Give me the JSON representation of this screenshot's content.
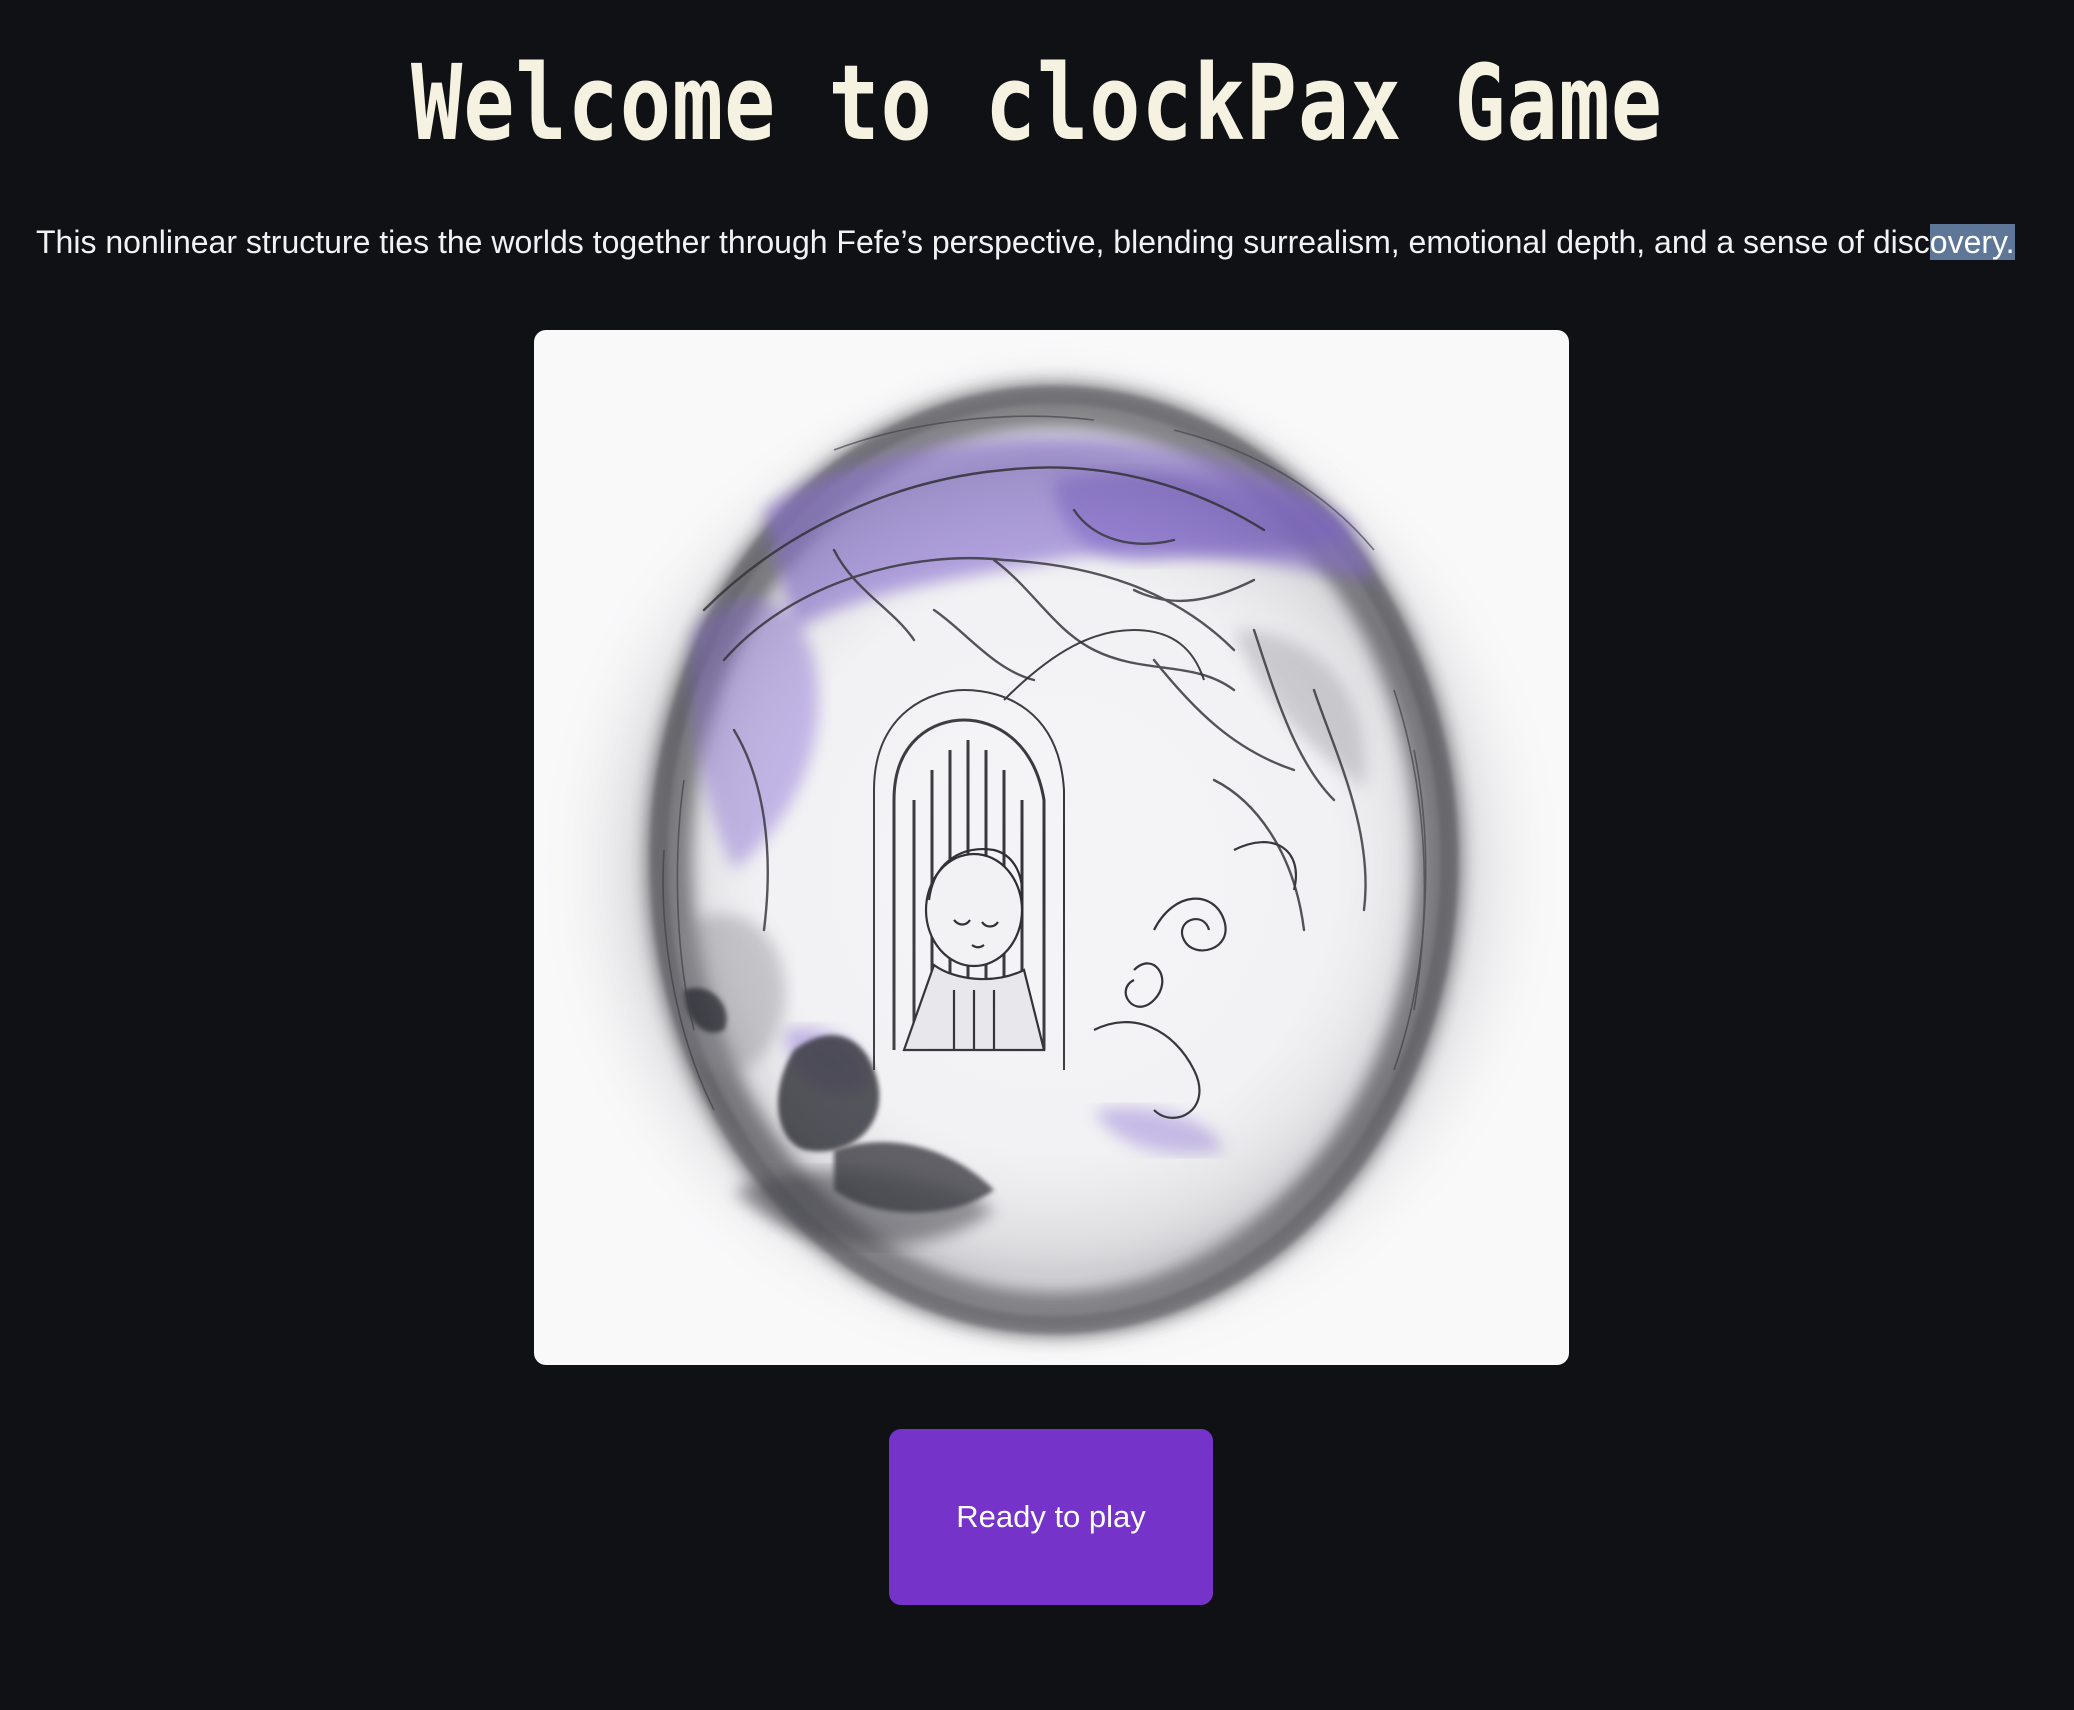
{
  "header": {
    "title": "Welcome to clockPax Game"
  },
  "intro": {
    "text_main": "This nonlinear structure ties the worlds together through Fefe’s perspective, blending surrealism, emotional depth, and a sense of disc",
    "text_selected": "overy."
  },
  "artwork": {
    "icon": "ink-illustration-girl-in-gate",
    "accent_color": "#8a6fd6"
  },
  "actions": {
    "play_label": "Ready to play",
    "play_color": "#7533c9"
  },
  "colors": {
    "background": "#0f1115",
    "title": "#f6f2e1",
    "selection": "#5e7697"
  }
}
